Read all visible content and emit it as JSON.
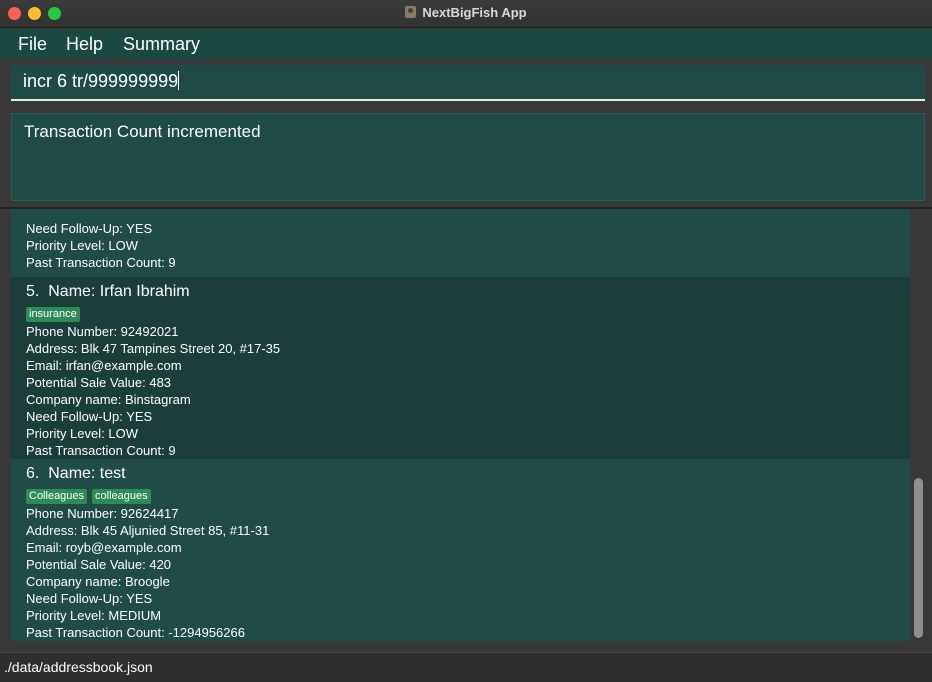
{
  "window": {
    "title": "NextBigFish App"
  },
  "menu": {
    "file": "File",
    "help": "Help",
    "summary": "Summary"
  },
  "command": {
    "value": "incr 6 tr/999999999"
  },
  "result": {
    "text": "Transaction Count incremented"
  },
  "persons": [
    {
      "follow_up": "Need Follow-Up: YES",
      "priority": "Priority Level: LOW",
      "transactions": "Past Transaction Count: 9"
    },
    {
      "index": "5.",
      "name": "Name: Irfan Ibrahim",
      "tags": [
        "insurance"
      ],
      "phone": "Phone Number: 92492021",
      "address": "Address: Blk 47 Tampines Street 20, #17-35",
      "email": "Email: irfan@example.com",
      "sale_value": "Potential Sale Value: 483",
      "company": "Company name: Binstagram",
      "follow_up": "Need Follow-Up: YES",
      "priority": "Priority Level: LOW",
      "transactions": "Past Transaction Count: 9"
    },
    {
      "index": "6.",
      "name": "Name: test",
      "tags": [
        "Colleagues",
        "colleagues"
      ],
      "phone": "Phone Number: 92624417",
      "address": "Address: Blk 45 Aljunied Street 85, #11-31",
      "email": "Email: royb@example.com",
      "sale_value": "Potential Sale Value: 420",
      "company": "Company name: Broogle",
      "follow_up": "Need Follow-Up: YES",
      "priority": "Priority Level: MEDIUM",
      "transactions": "Past Transaction Count: -1294956266"
    }
  ],
  "status": {
    "path": "./data/addressbook.json"
  },
  "colors": {
    "panel": "#1f4a45",
    "card_alt": "#1b3e3a",
    "tag": "#2e8b57"
  }
}
